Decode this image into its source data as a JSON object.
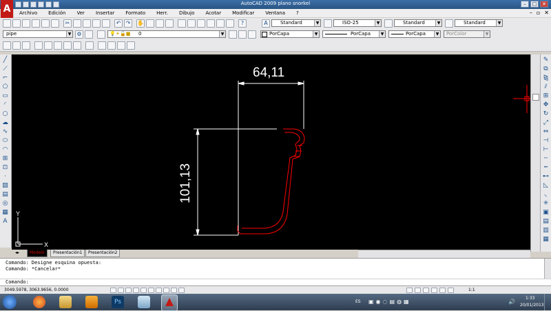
{
  "window": {
    "title": "AutoCAD 2009 plano snorkel",
    "app_icon": "A"
  },
  "menubar": {
    "items": [
      "Archivo",
      "Edición",
      "Ver",
      "Insertar",
      "Formato",
      "Herr.",
      "Dibujo",
      "Acotar",
      "Modificar",
      "Ventana",
      "?"
    ]
  },
  "toolbar": {
    "text_style": "Standard",
    "dim_style": "ISO-25",
    "table_style": "Standard",
    "multileader_style": "Standard",
    "workspace": "pipe",
    "layer": "0",
    "color": "PorCapa",
    "linetype": "PorCapa",
    "lineweight": "PorCapa",
    "plotstyle": "PorColor"
  },
  "drawing": {
    "dim_horizontal": "64,11",
    "dim_vertical": "101,13",
    "ucs_x": "X",
    "ucs_y": "Y",
    "colors": {
      "background": "#000000",
      "geometry": "#ff0000",
      "dimensions": "#ffffff",
      "crosshair": "#ff0000"
    }
  },
  "layout_tabs": [
    "Modelo",
    "Presentación1",
    "Presentación2"
  ],
  "command": {
    "history": [
      "Comando: Designe esquina opuesta:",
      "Comando: *Cancelar*"
    ],
    "prompt": "Comando:"
  },
  "status": {
    "coordinates": "3049.5978, 3063.9656, 0.0000",
    "annotation_scale": "1:1"
  },
  "taskbar": {
    "language": "ES",
    "time": "1:33",
    "date": "20/01/2013",
    "apps": [
      "windows-start",
      "firefox",
      "explorer",
      "outlook",
      "photoshop",
      "file-manager",
      "autocad"
    ]
  }
}
